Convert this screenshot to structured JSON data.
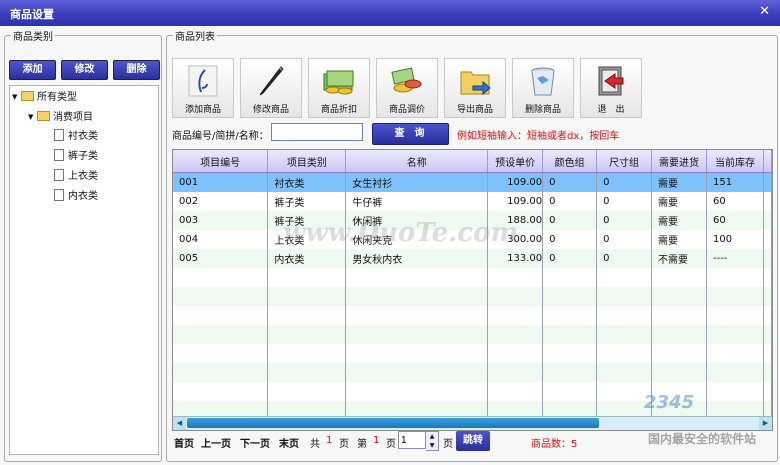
{
  "window": {
    "title": "商品设置",
    "close_icon": "✕"
  },
  "category_panel": {
    "legend": "商品类别",
    "buttons": [
      "添加",
      "修改",
      "删除"
    ],
    "tree": {
      "root": "所有类型",
      "group": "消费项目",
      "items": [
        "衬衣类",
        "裤子类",
        "上衣类",
        "内衣类"
      ]
    }
  },
  "list_panel": {
    "legend": "商品列表",
    "toolbar": [
      {
        "label": "添加商品",
        "icon": "quill-icon"
      },
      {
        "label": "修改商品",
        "icon": "pen-icon"
      },
      {
        "label": "商品折扣",
        "icon": "money-icon"
      },
      {
        "label": "商品调价",
        "icon": "coins-icon"
      },
      {
        "label": "导出商品",
        "icon": "folder-export-icon"
      },
      {
        "label": "删除商品",
        "icon": "trash-icon"
      },
      {
        "label": "退　出",
        "icon": "exit-door-icon"
      }
    ],
    "search": {
      "label": "商品编号/简拼/名称：",
      "value": "",
      "button": "查询",
      "hint": "例如短袖输入：短袖或者dx，按回车"
    },
    "table": {
      "columns": [
        "项目编号",
        "项目类别",
        "名称",
        "预设单价",
        "颜色组",
        "尺寸组",
        "需要进货",
        "当前库存"
      ],
      "rows": [
        [
          "001",
          "衬衣类",
          "女生衬衫",
          "109.00",
          "0",
          "0",
          "需要",
          "151"
        ],
        [
          "002",
          "裤子类",
          "牛仔裤",
          "109.00",
          "0",
          "0",
          "需要",
          "60"
        ],
        [
          "003",
          "裤子类",
          "休闲裤",
          "188.00",
          "0",
          "0",
          "需要",
          "60"
        ],
        [
          "004",
          "上衣类",
          "休闲夹克",
          "300.00",
          "0",
          "0",
          "需要",
          "100"
        ],
        [
          "005",
          "内衣类",
          "男女秋内衣",
          "133.00",
          "0",
          "0",
          "不需要",
          "----"
        ]
      ],
      "selected_row": 0
    },
    "pager": {
      "first": "首页",
      "prev": "上一页",
      "next": "下一页",
      "last": "末页",
      "total_prefix": "共",
      "total_pages": "1",
      "page_suffix": "页",
      "current_prefix": "第",
      "current_page": "1",
      "input_value": "1",
      "jump": "跳转",
      "count_label": "商品数：5"
    }
  },
  "watermark": {
    "center": "www.DuoTe.com",
    "logo": "2345",
    "text": "国内最安全的软件站"
  }
}
